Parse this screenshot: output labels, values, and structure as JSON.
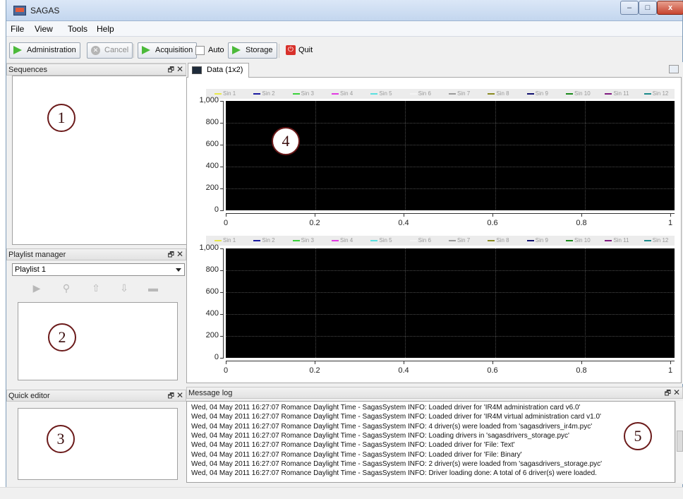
{
  "window": {
    "title": "SAGAS",
    "controls": {
      "minimize": "–",
      "maximize": "□",
      "close": "x"
    }
  },
  "menubar": {
    "items": [
      "File",
      "View",
      "Tools",
      "Help"
    ]
  },
  "toolbar": {
    "administration": "Administration",
    "cancel": "Cancel",
    "acquisition": "Acquisition",
    "auto": "Auto",
    "storage": "Storage",
    "quit": "Quit",
    "accent_green": "#4cba3a",
    "quit_red": "#d8312b"
  },
  "panels": {
    "sequences": {
      "title": "Sequences",
      "marker": "1"
    },
    "playlist_manager": {
      "title": "Playlist manager",
      "selected": "Playlist 1",
      "marker": "2"
    },
    "quick_editor": {
      "title": "Quick editor",
      "marker": "3"
    },
    "data": {
      "tab_label": "Data (1x2)",
      "marker": "4"
    },
    "message_log": {
      "title": "Message log",
      "marker": "5"
    }
  },
  "dock_controls": {
    "float": "🗗",
    "close": "✕"
  },
  "chart_data": [
    {
      "type": "line",
      "title": "",
      "xlabel": "",
      "ylabel": "",
      "xlim": [
        0,
        1
      ],
      "ylim": [
        0,
        1000
      ],
      "xticks": [
        "0",
        "0.2",
        "0.4",
        "0.6",
        "0.8",
        "1"
      ],
      "yticks": [
        "0",
        "200",
        "400",
        "600",
        "800",
        "1,000"
      ],
      "grid": true,
      "background": "#000000",
      "legend_position": "top",
      "series": [
        {
          "name": "Sin 1",
          "color": "#e8e84a",
          "values": []
        },
        {
          "name": "Sin 2",
          "color": "#1a1aa0",
          "values": []
        },
        {
          "name": "Sin 3",
          "color": "#3ad23a",
          "values": []
        },
        {
          "name": "Sin 4",
          "color": "#e23ae2",
          "values": []
        },
        {
          "name": "Sin 5",
          "color": "#5ae0e0",
          "values": []
        },
        {
          "name": "Sin 6",
          "color": "#f4f4f4",
          "values": []
        },
        {
          "name": "Sin 7",
          "color": "#9a9a9a",
          "values": []
        },
        {
          "name": "Sin 8",
          "color": "#8a8a20",
          "values": []
        },
        {
          "name": "Sin 9",
          "color": "#101070",
          "values": []
        },
        {
          "name": "Sin 10",
          "color": "#1a8a1a",
          "values": []
        },
        {
          "name": "Sin 11",
          "color": "#801a80",
          "values": []
        },
        {
          "name": "Sin 12",
          "color": "#1a8a8a",
          "values": []
        }
      ]
    },
    {
      "type": "line",
      "title": "",
      "xlabel": "",
      "ylabel": "",
      "xlim": [
        0,
        1
      ],
      "ylim": [
        0,
        1000
      ],
      "xticks": [
        "0",
        "0.2",
        "0.4",
        "0.6",
        "0.8",
        "1"
      ],
      "yticks": [
        "0",
        "200",
        "400",
        "600",
        "800",
        "1,000"
      ],
      "grid": true,
      "background": "#000000",
      "legend_position": "top",
      "series": [
        {
          "name": "Sin 1",
          "color": "#e8e84a",
          "values": []
        },
        {
          "name": "Sin 2",
          "color": "#1a1aa0",
          "values": []
        },
        {
          "name": "Sin 3",
          "color": "#3ad23a",
          "values": []
        },
        {
          "name": "Sin 4",
          "color": "#e23ae2",
          "values": []
        },
        {
          "name": "Sin 5",
          "color": "#5ae0e0",
          "values": []
        },
        {
          "name": "Sin 6",
          "color": "#f4f4f4",
          "values": []
        },
        {
          "name": "Sin 7",
          "color": "#9a9a9a",
          "values": []
        },
        {
          "name": "Sin 8",
          "color": "#8a8a20",
          "values": []
        },
        {
          "name": "Sin 9",
          "color": "#101070",
          "values": []
        },
        {
          "name": "Sin 10",
          "color": "#1a8a1a",
          "values": []
        },
        {
          "name": "Sin 11",
          "color": "#801a80",
          "values": []
        },
        {
          "name": "Sin 12",
          "color": "#1a8a8a",
          "values": []
        }
      ]
    }
  ],
  "log": {
    "lines": [
      "Wed, 04 May 2011 16:27:07 Romance Daylight Time - SagasSystem INFO: Loaded driver for 'IR4M administration card v6.0'",
      "Wed, 04 May 2011 16:27:07 Romance Daylight Time - SagasSystem INFO: Loaded driver for 'IR4M virtual administration card v1.0'",
      "Wed, 04 May 2011 16:27:07 Romance Daylight Time - SagasSystem INFO: 4 driver(s) were loaded from 'sagasdrivers_ir4m.pyc'",
      "Wed, 04 May 2011 16:27:07 Romance Daylight Time - SagasSystem INFO: Loading drivers in 'sagasdrivers_storage.pyc'",
      "Wed, 04 May 2011 16:27:07 Romance Daylight Time - SagasSystem INFO: Loaded driver for 'File: Text'",
      "Wed, 04 May 2011 16:27:07 Romance Daylight Time - SagasSystem INFO: Loaded driver for 'File: Binary'",
      "Wed, 04 May 2011 16:27:07 Romance Daylight Time - SagasSystem INFO: 2 driver(s) were loaded from 'sagasdrivers_storage.pyc'",
      "Wed, 04 May 2011 16:27:07 Romance Daylight Time - SagasSystem INFO: Driver loading done: A total of 6 driver(s) were loaded."
    ]
  }
}
